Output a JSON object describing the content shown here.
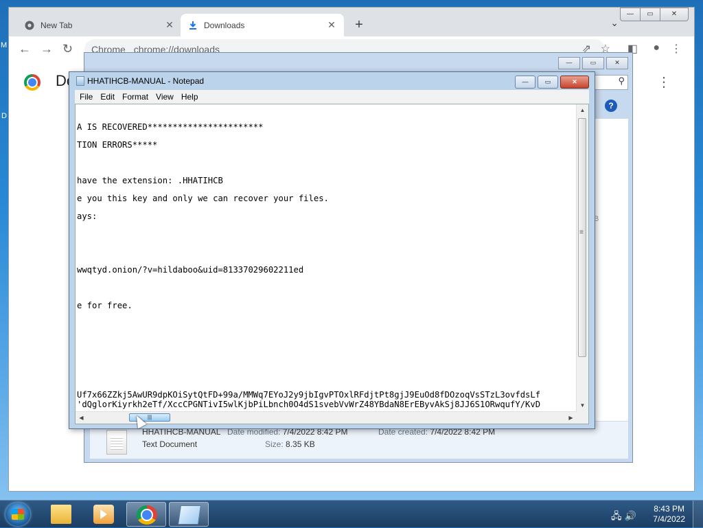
{
  "desktop": {
    "frag1": "M",
    "frag2": "D"
  },
  "chrome": {
    "tabs": [
      {
        "label": "New Tab",
        "close": "✕"
      },
      {
        "label": "Downloads",
        "close": "✕"
      }
    ],
    "new_tab": "+",
    "tab_search": "⌄",
    "win_minimize": "—",
    "win_maximize": "▭",
    "win_close": "✕",
    "back": "←",
    "forward": "→",
    "reload": "↻",
    "omnibox_site": "Chrome",
    "omnibox_url": "chrome://downloads",
    "share": "⇗",
    "bookmark": "☆",
    "sidepanel": "◧",
    "profile": "●",
    "menu": "⋮",
    "page_title": "Do",
    "page_menu": "⋮"
  },
  "explorer": {
    "minimize": "—",
    "maximize": "▭",
    "close": "✕",
    "search_icon": "⚲",
    "help": "?",
    "frag": "B",
    "file": {
      "name": "HHATIHCB-MANUAL",
      "type": "Text Document",
      "modified_label": "Date modified:",
      "modified": "7/4/2022 8:42 PM",
      "size_label": "Size:",
      "size": "8.35 KB",
      "created_label": "Date created:",
      "created": "7/4/2022 8:42 PM"
    }
  },
  "notepad": {
    "title": "HHATIHCB-MANUAL - Notepad",
    "minimize": "—",
    "maximize": "▭",
    "close": "✕",
    "menus": [
      "File",
      "Edit",
      "Format",
      "View",
      "Help"
    ],
    "lines": [
      "A IS RECOVERED***********************",
      "TION ERRORS*****",
      "have the extension: .HHATIHCB",
      "e you this key and only we can recover your files.",
      "ays:",
      "wwqtyd.onion/?v=hildaboo&uid=81337029602211ed",
      "e for free.",
      "Uf7x66ZZkj5AwUR9dpKOiSytQtFD+99a/MMWq7EYoJ2y9jbIgvPTOxlRFdjtPt8gjJ9EuOd8fDOzoqVsSTzL3ovfdsLf",
      "'dQglorKiyrkh2eTf/XccCPGNTivI5wlKjbPiLbnch0O4dS1svebVvWrZ48YBdaN8ErEByvAkSj8JJ6S1ORwqufY/KvD"
    ],
    "scroll_up": "▲",
    "scroll_down": "▼",
    "scroll_left": "◀",
    "scroll_right": "▶",
    "hthumb_grip": "|||"
  },
  "taskbar": {
    "tray_icons": "🖧 🔊",
    "time": "8:43 PM",
    "date": "7/4/2022"
  }
}
